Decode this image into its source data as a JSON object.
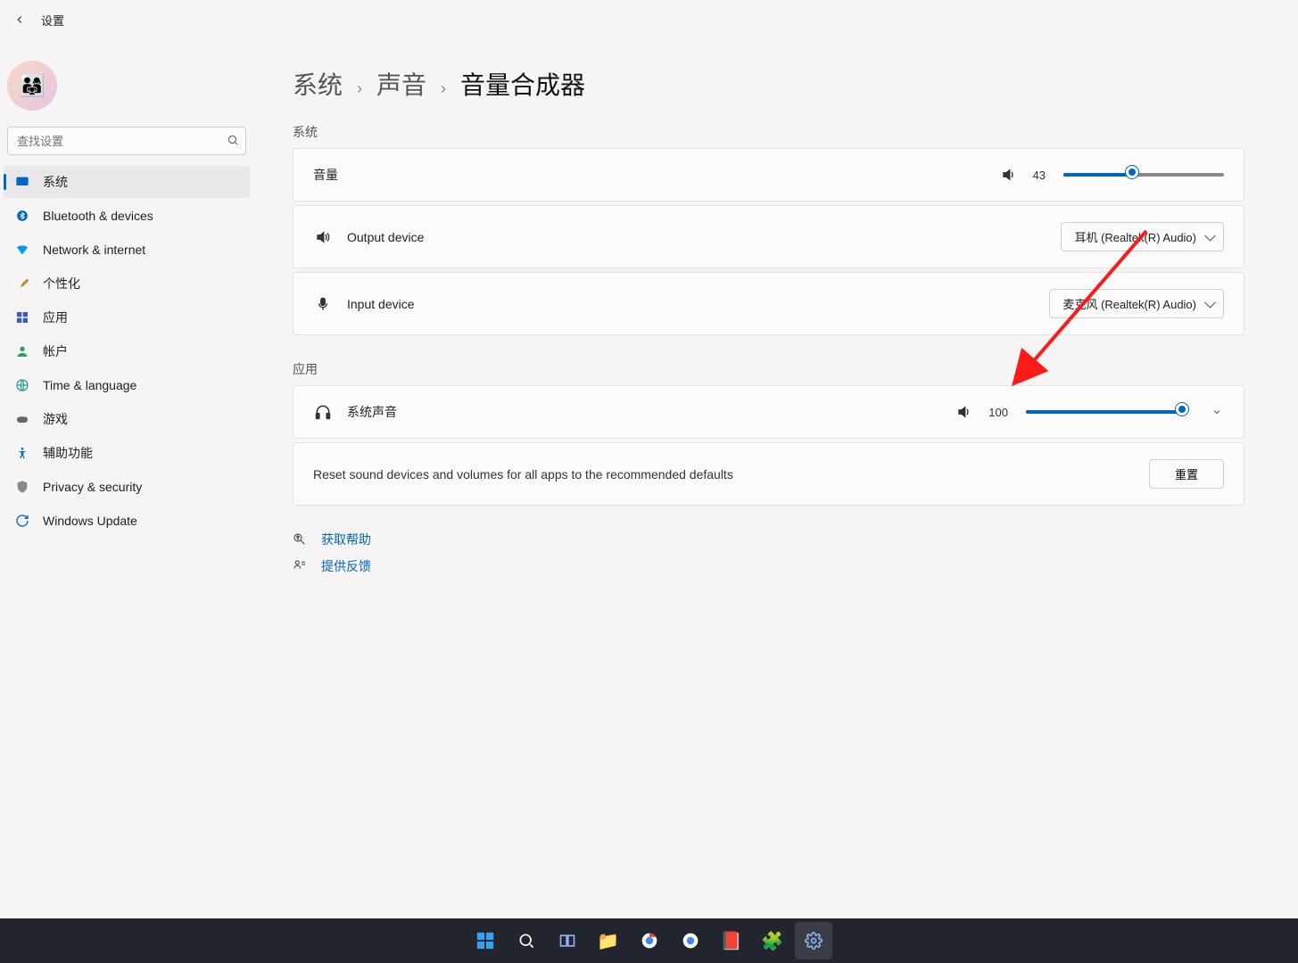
{
  "window": {
    "title": "设置"
  },
  "search": {
    "placeholder": "查找设置"
  },
  "nav": {
    "items": [
      {
        "label": "系统",
        "key": "system"
      },
      {
        "label": "Bluetooth & devices",
        "key": "bluetooth"
      },
      {
        "label": "Network & internet",
        "key": "network"
      },
      {
        "label": "个性化",
        "key": "personalization"
      },
      {
        "label": "应用",
        "key": "apps"
      },
      {
        "label": "帐户",
        "key": "accounts"
      },
      {
        "label": "Time & language",
        "key": "time"
      },
      {
        "label": "游戏",
        "key": "gaming"
      },
      {
        "label": "辅助功能",
        "key": "accessibility"
      },
      {
        "label": "Privacy & security",
        "key": "privacy"
      },
      {
        "label": "Windows Update",
        "key": "update"
      }
    ],
    "active": "system"
  },
  "breadcrumb": {
    "lvl1": "系统",
    "lvl2": "声音",
    "current": "音量合成器"
  },
  "sections": {
    "system_title": "系统",
    "apps_title": "应用"
  },
  "cards": {
    "volume": {
      "label": "音量",
      "value": "43",
      "percent": 43
    },
    "output": {
      "label": "Output device",
      "selected": "耳机 (Realtek(R) Audio)"
    },
    "input": {
      "label": "Input device",
      "selected": "麦克风 (Realtek(R) Audio)"
    },
    "system_sounds": {
      "label": "系统声音",
      "value": "100",
      "percent": 100
    },
    "reset": {
      "text": "Reset sound devices and volumes for all apps to the recommended defaults",
      "button": "重置"
    }
  },
  "help": {
    "get_help": "获取帮助",
    "feedback": "提供反馈"
  },
  "colors": {
    "accent": "#0067c0"
  }
}
